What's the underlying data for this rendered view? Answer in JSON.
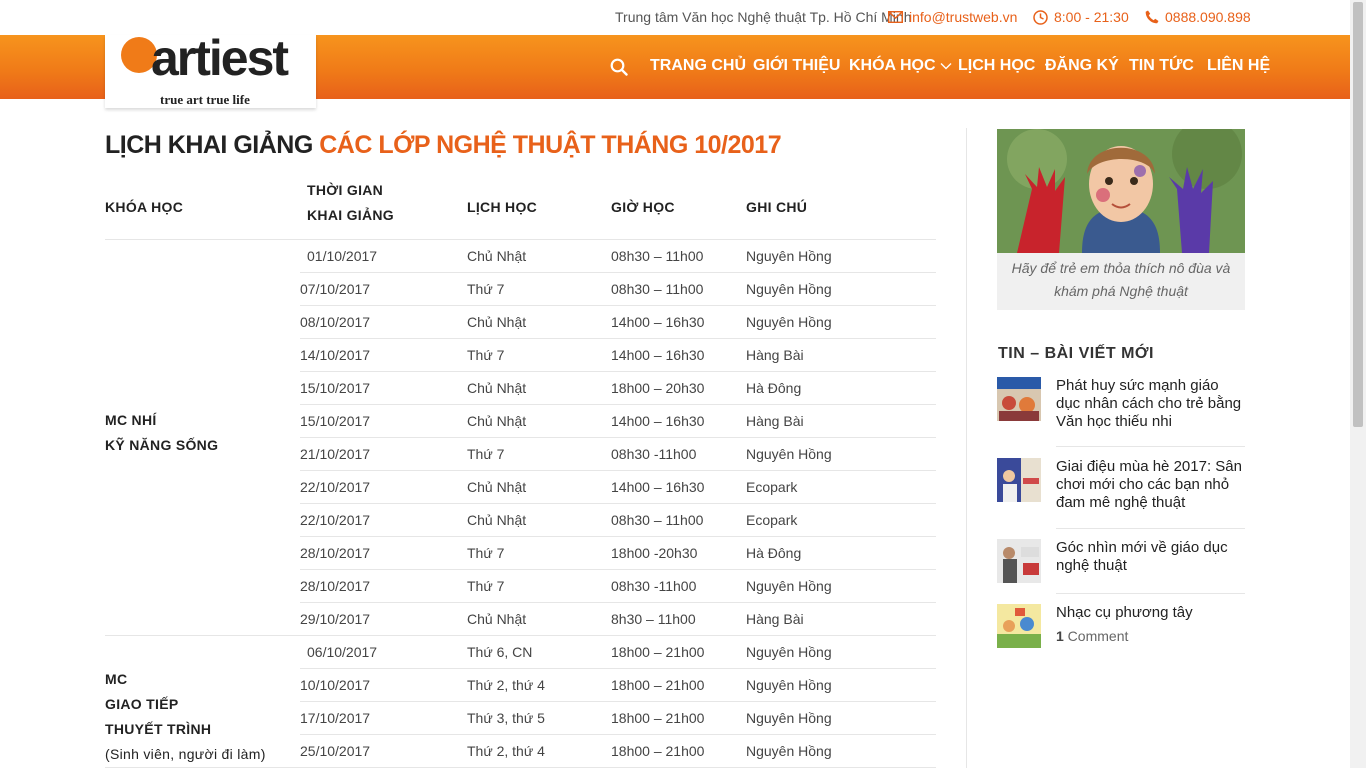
{
  "topbar": {
    "center_name": "Trung tâm Văn học Nghệ thuật Tp. Hồ Chí Minh",
    "email": "info@trustweb.vn",
    "hours": "8:00 - 21:30",
    "phone": "0888.090.898"
  },
  "brand": {
    "logo_word": "artiest",
    "tagline": "true art  true life",
    "accent_color": "#e8611a"
  },
  "nav": {
    "items": [
      "TRANG CHỦ",
      "GIỚI THIỆU",
      "KHÓA HỌC",
      "LỊCH HỌC",
      "ĐĂNG KÝ",
      "TIN TỨC",
      "LIÊN HỆ"
    ],
    "icons": [
      "search-icon",
      "chevron-down-icon"
    ]
  },
  "page": {
    "title_main": "LỊCH KHAI GIẢNG ",
    "title_accent": "CÁC LỚP NGHỆ THUẬT THÁNG 10/2017"
  },
  "table": {
    "headers": {
      "course": "KHÓA HỌC",
      "start_line1": "THỜI GIAN",
      "start_line2": "KHAI GIẢNG",
      "schedule": "LỊCH HỌC",
      "time": "GIỜ HỌC",
      "note": "GHI CHÚ"
    },
    "groups": [
      {
        "lines": [
          "MC NHÍ",
          "KỸ NĂNG SỐNG"
        ],
        "rows": [
          [
            "01/10/2017",
            "Chủ Nhật",
            "08h30 – 11h00",
            "Nguyên Hồng"
          ],
          [
            "07/10/2017",
            "Thứ 7",
            "08h30 – 11h00",
            "Nguyên Hồng"
          ],
          [
            "08/10/2017",
            "Chủ Nhật",
            "14h00 – 16h30",
            "Nguyên Hồng"
          ],
          [
            "14/10/2017",
            "Thứ 7",
            "14h00 – 16h30",
            "Hàng Bài"
          ],
          [
            "15/10/2017",
            "Chủ Nhật",
            "18h00 – 20h30",
            "Hà Đông"
          ],
          [
            "15/10/2017",
            "Chủ Nhật",
            "14h00 – 16h30",
            "Hàng Bài"
          ],
          [
            "21/10/2017",
            "Thứ 7",
            "08h30 -11h00",
            "Nguyên Hồng"
          ],
          [
            "22/10/2017",
            "Chủ Nhật",
            "14h00 – 16h30",
            "Ecopark"
          ],
          [
            "22/10/2017",
            "Chủ Nhật",
            "08h30 – 11h00",
            "Ecopark"
          ],
          [
            "28/10/2017",
            "Thứ 7",
            "18h00 -20h30",
            "Hà Đông"
          ],
          [
            "28/10/2017",
            "Thứ 7",
            "08h30 -11h00",
            "Nguyên Hồng"
          ],
          [
            "29/10/2017",
            "Chủ Nhật",
            "8h30 – 11h00",
            "Hàng Bài"
          ]
        ]
      },
      {
        "lines": [
          "MC",
          "GIAO TIẾP",
          "THUYẾT TRÌNH",
          "(Sinh viên, người đi làm)"
        ],
        "rows": [
          [
            "06/10/2017",
            "Thứ 6, CN",
            "18h00 – 21h00",
            "Nguyên Hồng"
          ],
          [
            "10/10/2017",
            "Thứ 2, thứ 4",
            "18h00 – 21h00",
            "Nguyên Hồng"
          ],
          [
            "17/10/2017",
            "Thứ 3, thứ 5",
            "18h00 – 21h00",
            "Nguyên Hồng"
          ],
          [
            "25/10/2017",
            "Thứ 2, thứ 4",
            "18h00 – 21h00",
            "Nguyên Hồng"
          ]
        ]
      }
    ]
  },
  "sidebar": {
    "feature_caption": "Hãy để trẻ em thỏa thích nô đùa và khám phá Nghệ thuật",
    "section_title": "TIN – BÀI VIẾT MỚI",
    "posts": [
      {
        "title": "Phát huy sức mạnh giáo dục nhân cách cho trẻ bằng Văn học thiếu nhi"
      },
      {
        "title": "Giai điệu mùa hè 2017: Sân chơi mới cho các bạn nhỏ đam mê nghệ thuật"
      },
      {
        "title": "Góc nhìn mới về giáo dục nghệ thuật"
      },
      {
        "title": "Nhạc cụ phương tây",
        "comment_count": "1",
        "comment_label": " Comment"
      }
    ]
  }
}
